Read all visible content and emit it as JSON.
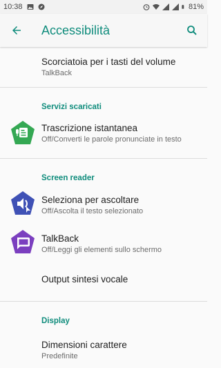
{
  "status_bar": {
    "time": "10:38",
    "battery": "81%"
  },
  "app_bar": {
    "title": "Accessibilità"
  },
  "items": {
    "volume_shortcut": {
      "title": "Scorciatoia per i tasti del volume",
      "subtitle": "TalkBack"
    },
    "live_transcribe": {
      "title": "Trascrizione istantanea",
      "subtitle": "Off/Converti le parole pronunciate in testo"
    },
    "select_to_speak": {
      "title": "Seleziona per ascoltare",
      "subtitle": "Off/Ascolta il testo selezionato"
    },
    "talkback": {
      "title": "TalkBack",
      "subtitle": "Off/Leggi gli elementi sullo schermo"
    },
    "tts_output": {
      "title": "Output sintesi vocale"
    },
    "font_size": {
      "title": "Dimensioni carattere",
      "subtitle": "Predefinite"
    }
  },
  "sections": {
    "downloaded": "Servizi scaricati",
    "screen_reader": "Screen reader",
    "display": "Display"
  },
  "colors": {
    "accent": "#0f8c7c",
    "live_transcribe_icon": "#34a853",
    "select_to_speak_icon": "#3f51b5",
    "talkback_icon": "#7b3fbf"
  }
}
